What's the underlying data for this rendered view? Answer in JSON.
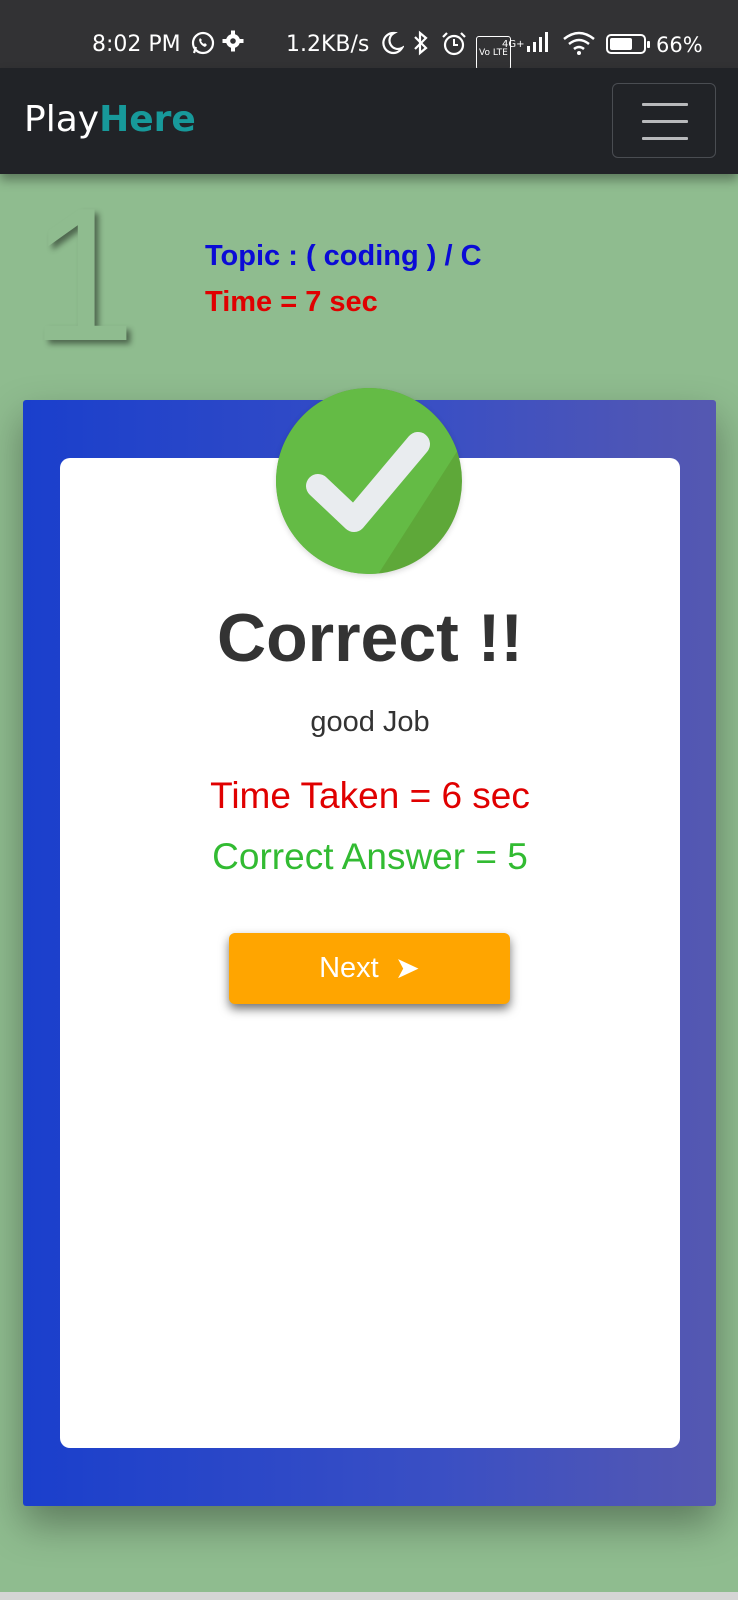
{
  "status_bar": {
    "time": "8:02 PM",
    "speed": "1.2KB/s",
    "volte": "Vo LTE",
    "network": "4G+",
    "battery_percent": "66%",
    "battery_level": 0.66
  },
  "navbar": {
    "brand_part1": "Play",
    "brand_part2": "Here",
    "menu_icon": "hamburger-icon"
  },
  "question": {
    "number": "1",
    "topic": "Topic : ( coding ) / C",
    "time": "Time = 7 sec"
  },
  "result": {
    "icon": "checkmark-icon",
    "title": "Correct !!",
    "subtitle": "good Job",
    "time_taken": "Time Taken = 6 sec",
    "correct_answer": "Correct Answer = 5",
    "next_label": "Next",
    "next_arrow": "➤"
  },
  "colors": {
    "background": "#8fbc8f",
    "brand_accent": "#17999a",
    "card": "#1a3fcc",
    "next_button": "#ffa500",
    "correct_green": "#32bb32",
    "error_red": "#e00000",
    "topic_blue": "#0b0bd6"
  }
}
